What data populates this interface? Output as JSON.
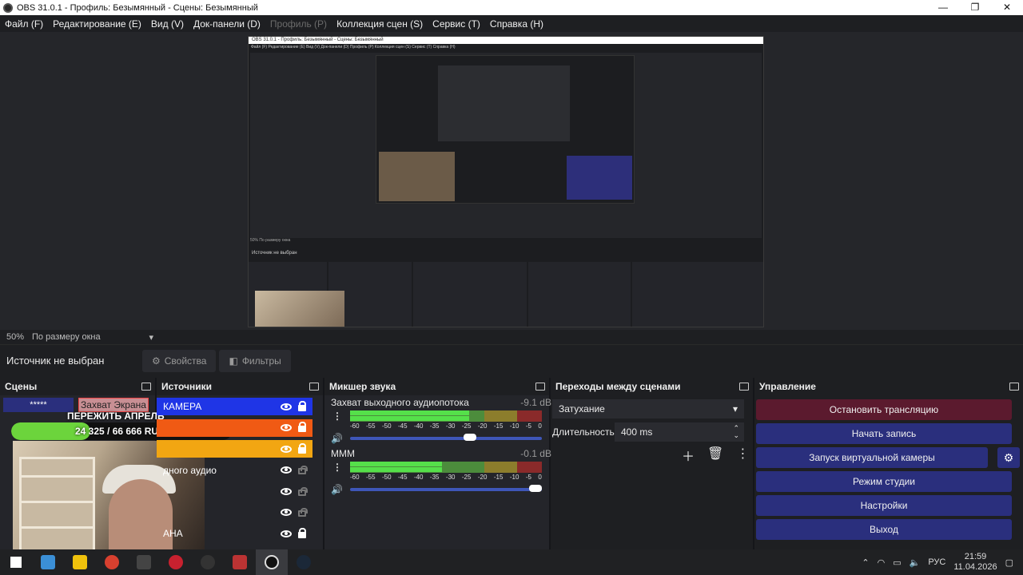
{
  "window": {
    "title": "OBS 31.0.1 - Профиль: Безымянный - Сцены: Безымянный",
    "controls": [
      "—",
      "❐",
      "✕"
    ]
  },
  "menu": [
    {
      "label": "Файл (F)",
      "enabled": true
    },
    {
      "label": "Редактирование (E)",
      "enabled": true
    },
    {
      "label": "Вид (V)",
      "enabled": true
    },
    {
      "label": "Док-панели (D)",
      "enabled": true
    },
    {
      "label": "Профиль (P)",
      "enabled": false
    },
    {
      "label": "Коллекция сцен (S)",
      "enabled": true
    },
    {
      "label": "Сервис (T)",
      "enabled": true
    },
    {
      "label": "Справка (H)",
      "enabled": true
    }
  ],
  "nested_preview": {
    "title": "OBS 31.0.1 - Профиль: Безымянный - Сцены: Безымянный",
    "menu": "Файл (F)  Редактирование (E)  Вид (V)  Док-панели (D)  Профиль (P)  Коллекция сцен (S)  Сервис (T)  Справка (H)",
    "status": "50%    По размеру окна",
    "source": "Источник не выбран"
  },
  "status": {
    "zoom": "50%",
    "fit": "По размеру окна"
  },
  "source_bar": {
    "label": "Источник не выбран",
    "properties": "Свойства",
    "filters": "Фильтры"
  },
  "scenes": {
    "title": "Сцены",
    "items": [
      "*****"
    ],
    "overlay_label": "Захват Экрана",
    "banner": "ПЕРЕЖИТЬ АПРЕЛЬ",
    "progress_text": "24 325 / 66 666 RUB",
    "progress_fraction": 0.36
  },
  "sources": {
    "title": "Источники",
    "rows": [
      {
        "label": "КАМЕРА",
        "color": "#1f35e6",
        "locked": true
      },
      {
        "label": "",
        "color": "#f05a14",
        "locked": true
      },
      {
        "label": "",
        "color": "#f2a612",
        "locked": true
      },
      {
        "label": "дного аудио",
        "color": "",
        "locked": false
      },
      {
        "label": "",
        "color": "",
        "locked": false
      },
      {
        "label": "",
        "color": "",
        "locked": false
      },
      {
        "label": "АНА",
        "color": "",
        "locked": true
      }
    ]
  },
  "mixer": {
    "title": "Микшер звука",
    "scale": [
      "-60",
      "-55",
      "-50",
      "-45",
      "-40",
      "-35",
      "-30",
      "-25",
      "-20",
      "-15",
      "-10",
      "-5",
      "0"
    ],
    "tracks": [
      {
        "name": "Захват выходного аудиопотока",
        "db": "-9.1 dB",
        "level": 0.62,
        "volume": 0.66
      },
      {
        "name": "МММ",
        "db": "-0.1 dB",
        "level": 0.48,
        "volume": 1.0
      }
    ]
  },
  "transitions": {
    "title": "Переходы между сценами",
    "selected": "Затухание",
    "duration_label": "Длительность",
    "duration_value": "400 ms"
  },
  "controls": {
    "title": "Управление",
    "buttons": [
      "Остановить трансляцию",
      "Начать запись",
      "Запуск виртуальной камеры",
      "Режим студии",
      "Настройки",
      "Выход"
    ]
  },
  "taskbar": {
    "lang": "РУС",
    "time": "21:59",
    "date": "11.04.2026"
  }
}
